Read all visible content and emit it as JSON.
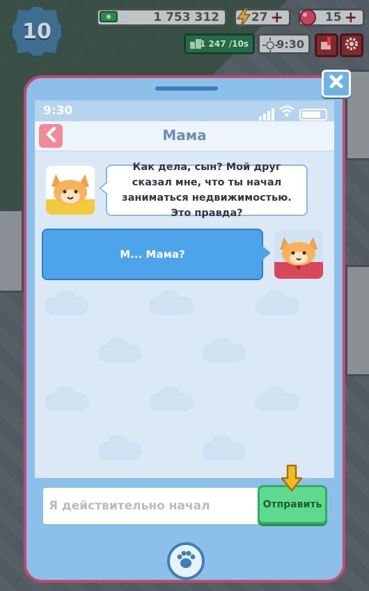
{
  "hud": {
    "level": "10",
    "cash": "1 753 312",
    "energy": "27",
    "gems": "15",
    "income": "1 247 /10s",
    "time": "9:30",
    "plus": "+"
  },
  "phone": {
    "status_time": "9:30",
    "contact_name": "Мама",
    "messages": [
      {
        "from": "mom",
        "text": "Как дела, сын? Мой друг сказал мне, что ты начал заниматься недвижимостью. Это правда?"
      },
      {
        "from": "me",
        "text": "М... Мама?"
      }
    ],
    "input_value": "Я действительно начал",
    "send_label": "Отправить"
  },
  "colors": {
    "phone_body": "#8cc0ea",
    "phone_border": "#c04a6e",
    "outgoing_bubble": "#4ea4ea",
    "send_button": "#5fd98e"
  },
  "icons": [
    "close-icon",
    "back-chevron-icon",
    "paw-icon",
    "signal-icon",
    "wifi-icon",
    "battery-icon",
    "arrow-down-hint-icon",
    "cash-icon",
    "lightning-icon",
    "gem-icon",
    "building-income-icon",
    "sun-icon",
    "notification-icon",
    "settings-gear-icon"
  ]
}
